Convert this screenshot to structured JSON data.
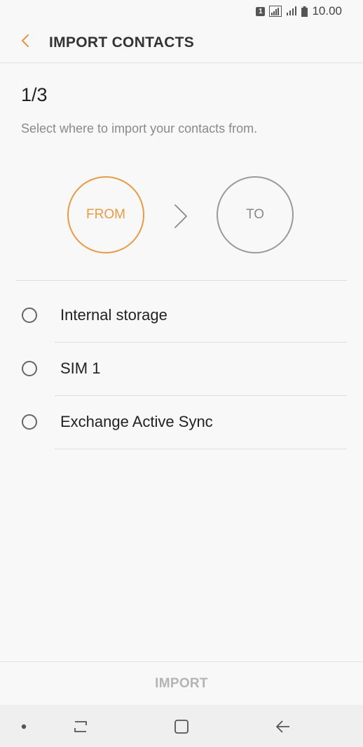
{
  "status_bar": {
    "sim_label": "1",
    "time": "10.00"
  },
  "header": {
    "title": "IMPORT CONTACTS"
  },
  "step": {
    "counter": "1/3",
    "instruction": "Select where to import your contacts from."
  },
  "flow": {
    "from_label": "FROM",
    "to_label": "TO"
  },
  "options": [
    {
      "label": "Internal storage"
    },
    {
      "label": "SIM 1"
    },
    {
      "label": "Exchange Active Sync"
    }
  ],
  "footer": {
    "import_label": "IMPORT"
  },
  "colors": {
    "accent": "#e89a45",
    "inactive": "#9a9a9a",
    "background": "#f8f8f8"
  }
}
